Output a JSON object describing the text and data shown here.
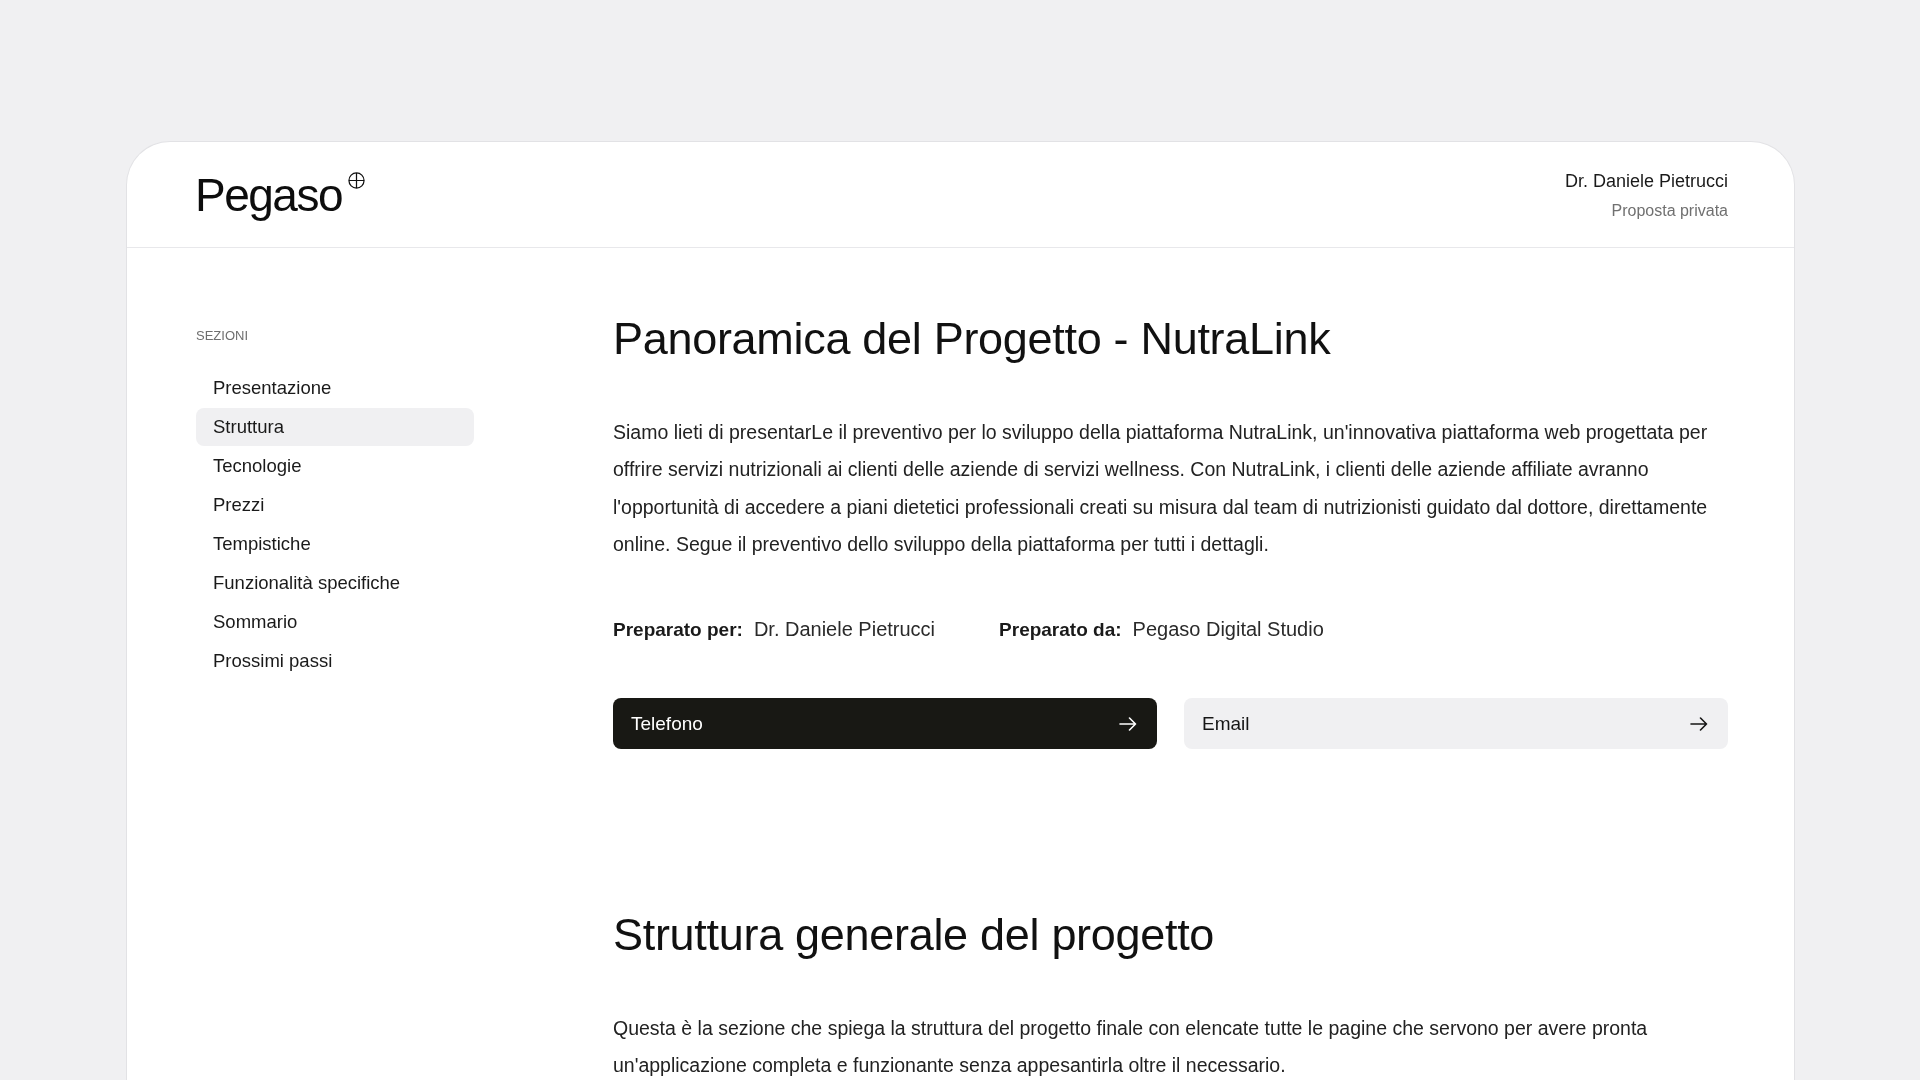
{
  "header": {
    "logo": "Pegaso",
    "client_name": "Dr. Daniele Pietrucci",
    "subtitle": "Proposta privata"
  },
  "sidebar": {
    "heading": "SEZIONI",
    "items": [
      {
        "label": "Presentazione",
        "selected": false
      },
      {
        "label": "Struttura",
        "selected": true
      },
      {
        "label": "Tecnologie",
        "selected": false
      },
      {
        "label": "Prezzi",
        "selected": false
      },
      {
        "label": "Tempistiche",
        "selected": false
      },
      {
        "label": "Funzionalità specifiche",
        "selected": false
      },
      {
        "label": "Sommario",
        "selected": false
      },
      {
        "label": "Prossimi passi",
        "selected": false
      }
    ]
  },
  "sections": [
    {
      "title": "Panoramica del Progetto - NutraLink",
      "paragraph": "Siamo lieti di presentarLe il preventivo per lo sviluppo della piattaforma NutraLink, un'innovativa piattaforma web progettata per offrire servizi nutrizionali ai clienti delle aziende di servizi wellness. Con NutraLink, i clienti delle aziende affiliate avranno l'opportunità di accedere a piani dietetici professionali creati su misura dal team di nutrizionisti guidato dal dottore, direttamente online. Segue il preventivo dello sviluppo della piattaforma per tutti i dettagli.",
      "prepared": [
        {
          "label": "Preparato per:",
          "value": "Dr. Daniele Pietrucci"
        },
        {
          "label": "Preparato da:",
          "value": "Pegaso Digital Studio"
        }
      ],
      "buttons": [
        {
          "label": "Telefono",
          "kind": "primary"
        },
        {
          "label": "Email",
          "kind": "secondary"
        }
      ]
    },
    {
      "title": "Struttura generale del progetto",
      "paragraph": "Questa è la sezione che spiega la struttura del progetto finale con elencate tutte le pagine che servono per avere pronta un'applicazione completa e funzionante senza appesantirla oltre il necessario."
    }
  ]
}
